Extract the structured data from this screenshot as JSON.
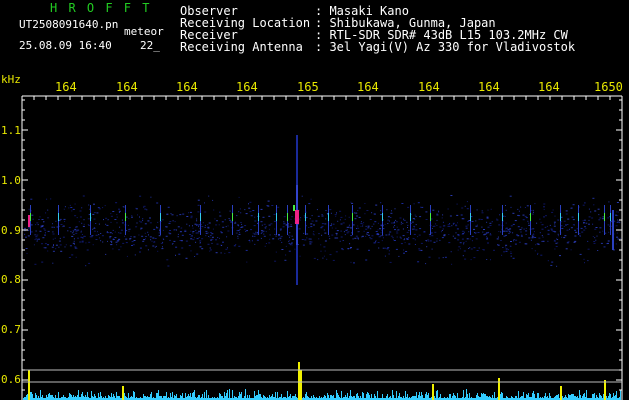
{
  "header": {
    "app_name": "H R O F F T",
    "file_name": "UT2508091640.pn",
    "file_suffix": "meteor",
    "timestamp": "25.08.09 16:40",
    "counter": "22_"
  },
  "info": {
    "rows": [
      {
        "label": "Observer",
        "value": ": Masaki Kano"
      },
      {
        "label": "Receiving Location",
        "value": ": Shibukawa, Gunma, Japan"
      },
      {
        "label": "Receiver",
        "value": ": RTL-SDR SDR# 43dB L15 103.2MHz CW"
      },
      {
        "label": "Receiving Antenna",
        "value": ": 3el Yagi(V) Az 330 for Vladivostok"
      }
    ]
  },
  "axis": {
    "unit": "kHz",
    "time_ticks": [
      "164",
      "164",
      "164",
      "164",
      "165",
      "164",
      "164",
      "164",
      "164",
      "1650"
    ],
    "freq_ticks": [
      "1.1",
      "1.0",
      "0.9",
      "0.8",
      "0.7",
      "0.6"
    ]
  },
  "colors": {
    "background": "#000000",
    "header_green": "#22cc22",
    "text_white": "#ffffff",
    "tick_yellow": "#e8e800",
    "noise_blue": "#1a2a9a",
    "histogram_cyan": "#33ccff"
  }
}
